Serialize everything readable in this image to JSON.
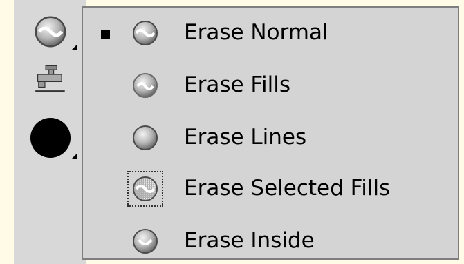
{
  "eraser_options": {
    "mode_icon": "eraser-mode-icon",
    "faucet_icon": "faucet-icon",
    "shape_icon": "eraser-shape-circle-icon",
    "shape_color": "#000000"
  },
  "menu": {
    "items": [
      {
        "label": "Erase Normal",
        "icon": "erase-normal-icon",
        "checked": true
      },
      {
        "label": "Erase Fills",
        "icon": "erase-fills-icon",
        "checked": false
      },
      {
        "label": "Erase Lines",
        "icon": "erase-lines-icon",
        "checked": false
      },
      {
        "label": "Erase Selected Fills",
        "icon": "erase-selected-fills-icon",
        "checked": false
      },
      {
        "label": "Erase Inside",
        "icon": "erase-inside-icon",
        "checked": false
      }
    ]
  },
  "colors": {
    "background": "#fffbe6",
    "menu_bg": "#d4d4d4",
    "menu_border": "#7e7e7e",
    "icon_face": "#a8a8a8"
  }
}
